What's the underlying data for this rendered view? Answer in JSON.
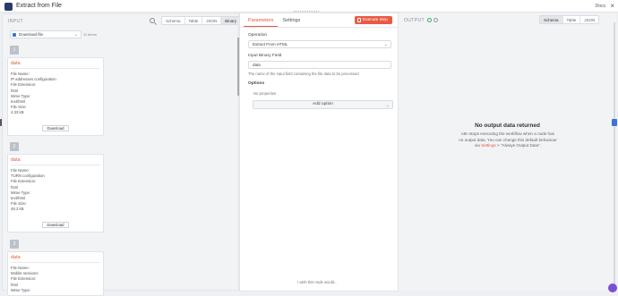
{
  "header": {
    "title": "Extract from File",
    "docs_label": "Docs",
    "close_glyph": "×"
  },
  "input": {
    "label": "INPUT",
    "view_tabs": [
      "Schema",
      "Table",
      "JSON",
      "Binary"
    ],
    "active_view": "Binary",
    "file_select": "Download file",
    "items_count": "11 items",
    "items": [
      {
        "num": "1",
        "title": "data",
        "lines": [
          "File Name:",
          "IP addresses configuration",
          "File Extension:",
          "html",
          "Mime Type:",
          "text/html",
          "File Size:",
          "4.33 kB"
        ],
        "button": "Download"
      },
      {
        "num": "2",
        "title": "data",
        "lines": [
          "File Name:",
          "TURN configuration",
          "File Extension:",
          "html",
          "Mime Type:",
          "text/html",
          "File Size:",
          "48.2 kB"
        ],
        "button": "Download"
      },
      {
        "num": "3",
        "title": "data",
        "lines": [
          "File Name:",
          "Mobile sessions",
          "File Extension:",
          "html",
          "Mime Type:"
        ],
        "button": ""
      }
    ]
  },
  "params": {
    "tabs": [
      "Parameters",
      "Settings"
    ],
    "active_tab": "Parameters",
    "execute_label": "Execute step",
    "operation_label": "Operation",
    "operation_value": "Extract From HTML",
    "binary_label": "Input Binary Field",
    "binary_value": "data",
    "binary_hint": "The name of the input field containing the file data to be processed",
    "options_label": "Options",
    "no_props": "No properties",
    "add_option": "Add option",
    "wish": "I wish this node would..."
  },
  "output": {
    "label": "OUTPUT",
    "view_tabs": [
      "Schema",
      "Table",
      "JSON"
    ],
    "active_view": "Schema",
    "empty_title": "No output data returned",
    "empty_msg_1": "n8n stops executing the workflow when a node has no output data. You can change this default behaviour via ",
    "empty_link": "Settings",
    "empty_msg_2": " > \"Always Output Data\"."
  },
  "colors": {
    "accent": "#ea5a44",
    "brand_blue": "#3a76d9",
    "node_icon": "#2b3a6b"
  }
}
